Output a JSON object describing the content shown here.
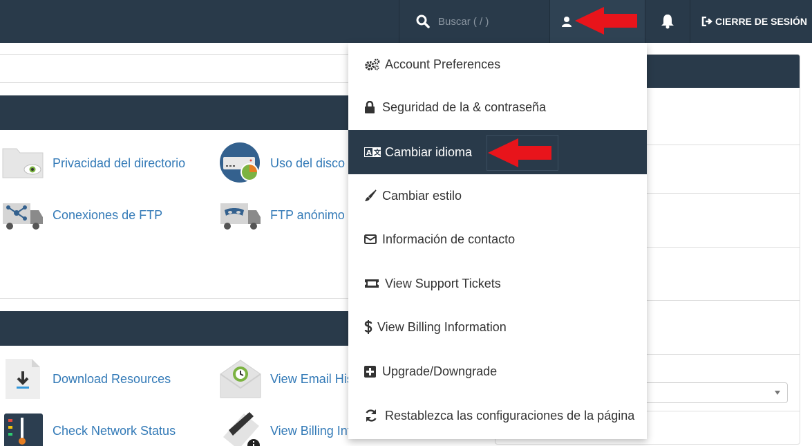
{
  "topbar": {
    "search_placeholder": "Buscar ( / )",
    "logout_label": "CIERRE DE SESIÓN",
    "icons": {
      "search": "search-icon",
      "user": "user-icon",
      "bell": "bell-icon",
      "logout": "logout-icon"
    }
  },
  "panel_files": {
    "items": [
      {
        "label": "Privacidad del directorio",
        "icon": "folder-eye-icon"
      },
      {
        "label": "Uso del disco",
        "icon": "disk-usage-icon"
      },
      {
        "label": "Conexiones de FTP",
        "icon": "ftp-truck-icon"
      },
      {
        "label": "FTP anónimo",
        "icon": "anonymous-ftp-truck-icon"
      }
    ]
  },
  "panel_support": {
    "items": [
      {
        "label": "Download Resources",
        "icon": "download-icon"
      },
      {
        "label": "View Email His",
        "icon": "email-history-icon"
      },
      {
        "label": "Check Network Status",
        "icon": "network-status-icon"
      },
      {
        "label": "View Billing Inf",
        "icon": "billing-card-icon"
      }
    ]
  },
  "user_menu": {
    "items": [
      {
        "label": "Account Preferences",
        "icon": "gears-icon"
      },
      {
        "label": "Seguridad de la & contraseña",
        "icon": "lock-icon"
      },
      {
        "label": "Cambiar idioma",
        "icon": "language-icon",
        "active": true
      },
      {
        "label": "Cambiar estilo",
        "icon": "brush-icon"
      },
      {
        "label": "Información de contacto",
        "icon": "envelope-icon"
      },
      {
        "label": "View Support Tickets",
        "icon": "ticket-icon"
      },
      {
        "label": "View Billing Information",
        "icon": "dollar-icon"
      },
      {
        "label": "Upgrade/Downgrade",
        "icon": "plus-square-icon"
      },
      {
        "label": "Restablezca las configuraciones de la página",
        "icon": "refresh-icon"
      }
    ]
  },
  "colors": {
    "topbar_bg": "#293a4a",
    "menu_active_bg": "#293a4a",
    "link": "#337ab7",
    "arrow": "#e8141b"
  }
}
